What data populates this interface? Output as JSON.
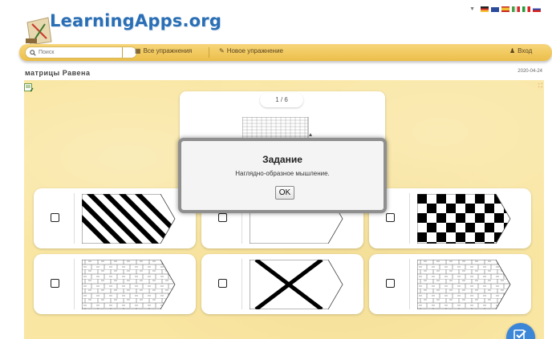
{
  "header": {
    "logo_text": "LearningApps.org",
    "logo_icon": "chalkboard-logo-icon",
    "language_caret": "▼"
  },
  "nav": {
    "search_placeholder": "Поиск",
    "all_exercises": "Все упражнения",
    "new_exercise": "Новое упражнение",
    "login": "Вход",
    "icons": [
      "search-icon",
      "grid-icon",
      "pencil-icon",
      "user-icon"
    ]
  },
  "page": {
    "title": "матрицы Равена",
    "date": "2020-04-24"
  },
  "task": {
    "counter": "1 / 6"
  },
  "answers": [
    {
      "pattern": "diagonal-stripes"
    },
    {
      "pattern": "blank"
    },
    {
      "pattern": "checkerboard"
    },
    {
      "pattern": "brick-grid"
    },
    {
      "pattern": "x-cross"
    },
    {
      "pattern": "brick-grid"
    }
  ],
  "modal": {
    "title": "Задание",
    "text": "Наглядно-образное мышление.",
    "ok": "OK"
  },
  "colors": {
    "brand_blue": "#2a6fb5",
    "nav_yellow": "#ecbe49",
    "stage_yellow": "#f9e6a2",
    "fab_blue": "#3c86d8"
  }
}
